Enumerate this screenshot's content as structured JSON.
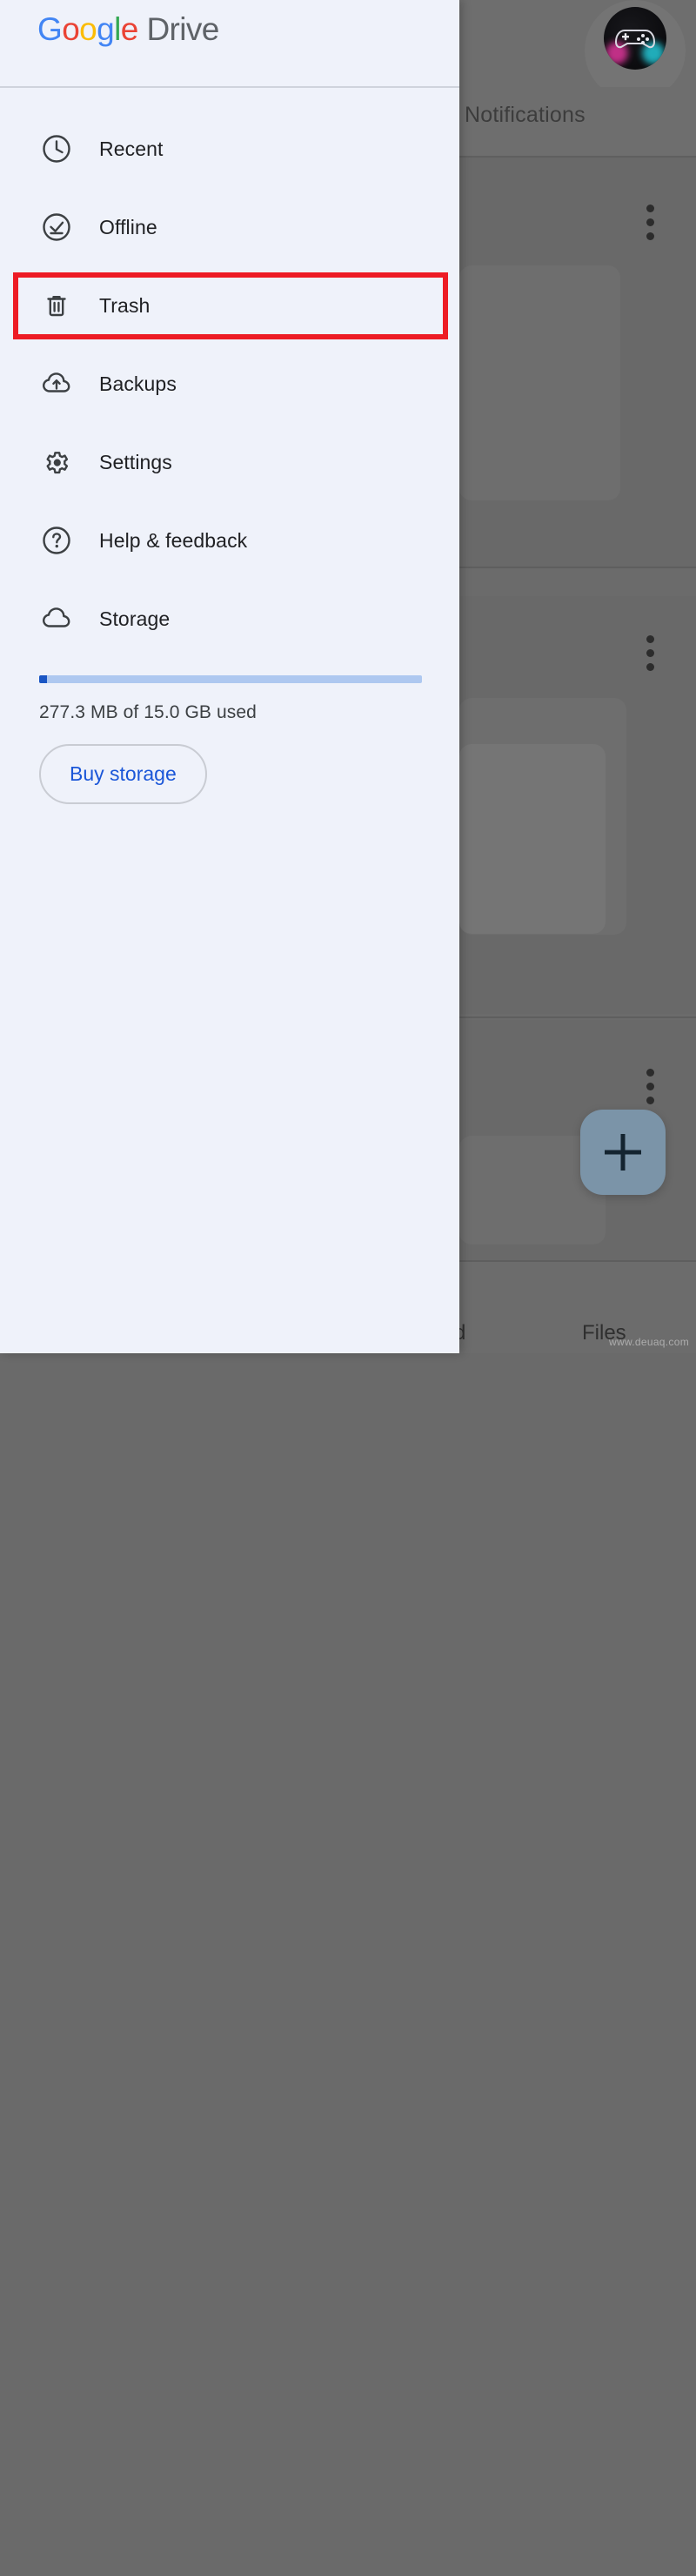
{
  "app": {
    "brand_google": "Google",
    "brand_product": "Drive",
    "brand_letters": [
      "G",
      "o",
      "o",
      "g",
      "l",
      "e"
    ],
    "accent_blue": "#4285f4",
    "accent_red": "#ea4335",
    "accent_yellow": "#fbbc05",
    "accent_green": "#34a853",
    "drive_gray": "#5f6368",
    "drawer_bg": "#eff2fa",
    "highlight_color": "#ed1c24"
  },
  "drawer": {
    "items": [
      {
        "label": "Recent",
        "icon": "clock-icon"
      },
      {
        "label": "Offline",
        "icon": "offline-check-icon"
      },
      {
        "label": "Trash",
        "icon": "trash-icon",
        "highlighted": true
      },
      {
        "label": "Backups",
        "icon": "cloud-upload-icon"
      },
      {
        "label": "Settings",
        "icon": "gear-icon"
      },
      {
        "label": "Help & feedback",
        "icon": "help-circle-icon"
      },
      {
        "label": "Storage",
        "icon": "cloud-icon"
      }
    ],
    "storage": {
      "usage_text": "277.3 MB of 15.0 GB used",
      "used_value": "277.3 MB",
      "total_value": "15.0 GB",
      "percent_used": 2,
      "bar_fill_color": "#1a56c4",
      "bar_track_color": "#aec8f0",
      "buy_label": "Buy storage",
      "buy_text_color": "#1a56d8"
    }
  },
  "background": {
    "tab_label": "Notifications",
    "avatar": "game-controller-avatar",
    "fab_label": "+",
    "bottom_nav": [
      {
        "label": "d",
        "icon": "shared-icon-partial"
      },
      {
        "label": "Files",
        "icon": "folder-icon"
      }
    ],
    "watermark": "www.deuaq.com",
    "overlay_color": "#6b6b6b"
  }
}
